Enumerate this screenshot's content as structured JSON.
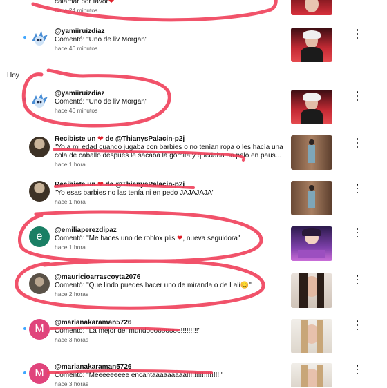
{
  "partial_top": {
    "comment_tail": "calamar por favor",
    "time": "hace 24 minutos"
  },
  "section_today": "Hoy",
  "items": [
    {
      "user": "@yamiiruizdiaz",
      "comment": "Comentó: \"Uno de liv Morgan\"",
      "time": "hace 46 minutos",
      "avatar_icon": "blue-cartoon-avatar",
      "thumb_icon": "red-portrait-thumbnail"
    },
    {
      "user": "@yamiiruizdiaz",
      "comment": "Comentó: \"Uno de liv Morgan\"",
      "time": "hace 46 minutos",
      "avatar_icon": "blue-cartoon-avatar",
      "thumb_icon": "red-portrait-thumbnail"
    },
    {
      "prefix": "Recibiste un",
      "suffix": "de @ThianysPalacin-p2j",
      "comment": "\"Yo a mi edad cuando jugaba con barbies o no tenían ropa o les hacía una cola de caballo después le sacaba la gomita y quedaba un pelo en paus...",
      "time": "hace 1 hora",
      "avatar_icon": "photo-avatar",
      "thumb_icon": "doll-thumbnail"
    },
    {
      "prefix": "Recibiste un",
      "suffix": "de @ThianysPalacin-p2j",
      "comment": "\"Yo esas barbies no las tenía ni en pedo JAJAJAJA\"",
      "time": "hace 1 hora",
      "avatar_icon": "photo-avatar",
      "thumb_icon": "doll-thumbnail"
    },
    {
      "user": "@emiliaperezdipaz",
      "letter": "e",
      "avatar_color": "#1a7f64",
      "comment": "Comentó: \"Me haces uno de roblox plis",
      "comment_tail": ", nueva seguidora\"",
      "time": "hace 1 hora",
      "thumb_icon": "roblox-thumbnail"
    },
    {
      "user": "@mauricioarrascoyta2076",
      "comment": "Comentó: \"Que lindo puedes hacer uno de miranda o de Lali",
      "comment_tail": "\"",
      "time": "hace 2 horas",
      "avatar_icon": "photo-avatar",
      "thumb_icon": "woman-portrait-thumbnail"
    },
    {
      "user": "@marianakaraman5726",
      "letter": "M",
      "avatar_color": "#e0447c",
      "comment": "Comentó: \"La mejor del mundooooooooo!!!!!!!!!\"",
      "time": "hace 3 horas",
      "thumb_icon": "girl-portrait-thumbnail"
    },
    {
      "user": "@marianakaraman5726",
      "letter": "M",
      "avatar_color": "#e0447c",
      "comment": "Comentó: \"Meeeeeeeee encantaaaaaaaaa!!!!!!!!!!!!!!!!!!\"",
      "time": "hace 3 horas",
      "thumb_icon": "girl-portrait-thumbnail"
    }
  ],
  "colors": {
    "annotation": "#f0405a",
    "unread_dot": "#3ea6ff",
    "heart": "#e0202a"
  }
}
